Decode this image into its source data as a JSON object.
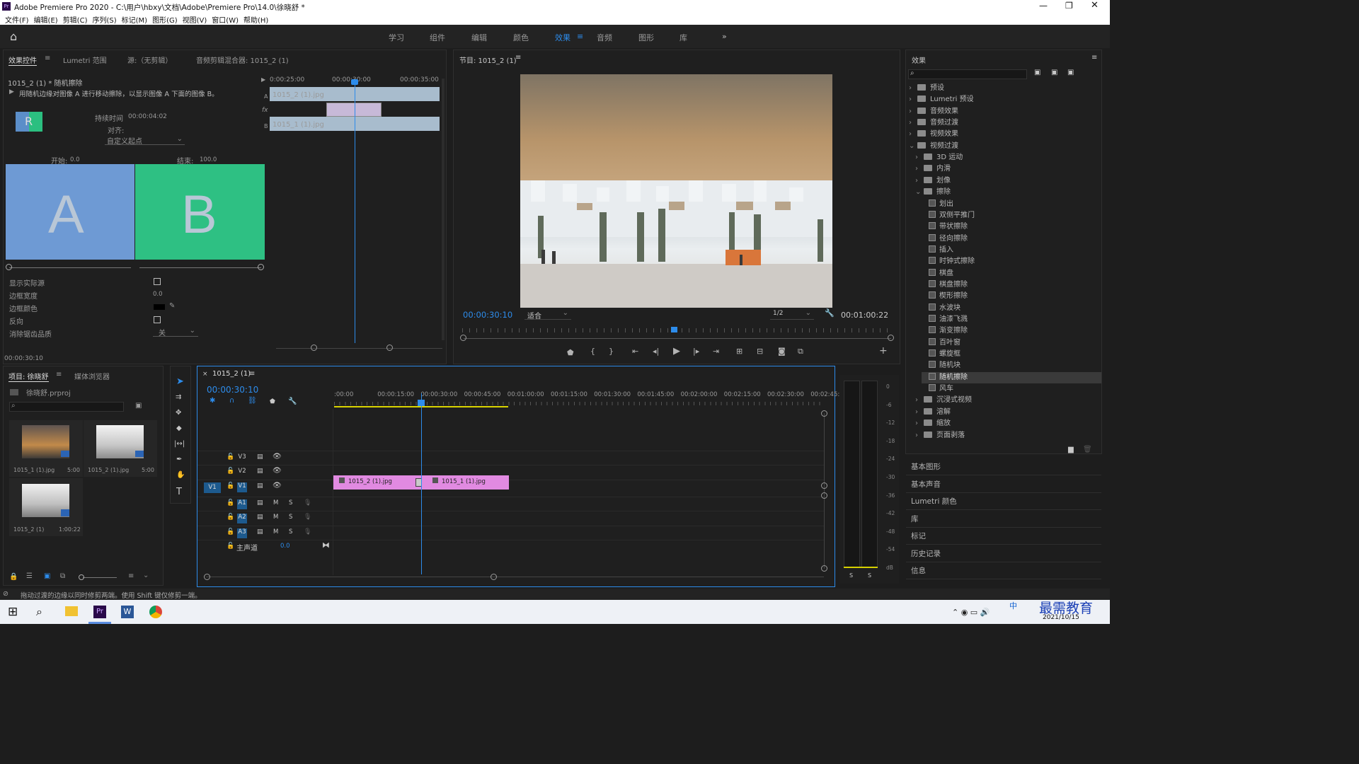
{
  "window": {
    "title": "Adobe Premiere Pro 2020 - C:\\用户\\hbxy\\文档\\Adobe\\Premiere Pro\\14.0\\徐晓舒 *",
    "app_icon": "Pr"
  },
  "menu": [
    "文件(F)",
    "编辑(E)",
    "剪辑(C)",
    "序列(S)",
    "标记(M)",
    "图形(G)",
    "视图(V)",
    "窗口(W)",
    "帮助(H)"
  ],
  "workspaces": [
    "学习",
    "组件",
    "编辑",
    "颜色",
    "效果",
    "音频",
    "图形",
    "库"
  ],
  "active_workspace": "效果",
  "effect_controls": {
    "tabs": [
      "效果控件",
      "Lumetri 范围",
      "源:（无剪辑）",
      "音频剪辑混合器: 1015_2 (1)"
    ],
    "clip_title": "1015_2 (1) * 随机擦除",
    "description": "用随机边缘对图像 A 进行移动擦除，以显示图像 A 下面的图像 B。",
    "duration_label": "持续时间",
    "duration": "00:00:04:02",
    "align_label": "对齐:",
    "align_value": "自定义起点",
    "start_label": "开始:",
    "start_value": "0.0",
    "end_label": "结束:",
    "end_value": "100.0",
    "a_label": "A",
    "b_label": "B",
    "thumb_letter": "R",
    "props": [
      {
        "label": "显示实际源",
        "value": ""
      },
      {
        "label": "边框宽度",
        "value": "0.0"
      },
      {
        "label": "边框颜色",
        "value": ""
      },
      {
        "label": "反向",
        "value": ""
      },
      {
        "label": "消除锯齿品质",
        "value": "关"
      }
    ],
    "ruler": [
      "0:00:25:00",
      "00:00:30:00",
      "00:00:35:00"
    ],
    "clip_a": "1015_2 (1).jpg",
    "clip_b": "1015_1 (1).jpg",
    "track_a": "A",
    "track_b": "B",
    "timecode": "00:00:30:10"
  },
  "program": {
    "title": "节目: 1015_2 (1)",
    "timecode": "00:00:30:10",
    "fit": "适合",
    "res": "1/2",
    "duration": "00:01:00:22"
  },
  "effects_panel": {
    "title": "效果",
    "tree": [
      {
        "label": "预设",
        "type": "folder",
        "level": 0,
        "open": false
      },
      {
        "label": "Lumetri 预设",
        "type": "folder",
        "level": 0,
        "open": false
      },
      {
        "label": "音频效果",
        "type": "folder",
        "level": 0,
        "open": false
      },
      {
        "label": "音频过渡",
        "type": "folder",
        "level": 0,
        "open": false
      },
      {
        "label": "视频效果",
        "type": "folder",
        "level": 0,
        "open": false
      },
      {
        "label": "视频过渡",
        "type": "folder",
        "level": 0,
        "open": true
      },
      {
        "label": "3D 运动",
        "type": "folder",
        "level": 1,
        "open": false
      },
      {
        "label": "内滑",
        "type": "folder",
        "level": 1,
        "open": false
      },
      {
        "label": "划像",
        "type": "folder",
        "level": 1,
        "open": false
      },
      {
        "label": "擦除",
        "type": "folder",
        "level": 1,
        "open": true
      },
      {
        "label": "划出",
        "type": "fx",
        "level": 2
      },
      {
        "label": "双侧平推门",
        "type": "fx",
        "level": 2
      },
      {
        "label": "带状擦除",
        "type": "fx",
        "level": 2
      },
      {
        "label": "径向擦除",
        "type": "fx",
        "level": 2
      },
      {
        "label": "插入",
        "type": "fx",
        "level": 2
      },
      {
        "label": "时钟式擦除",
        "type": "fx",
        "level": 2
      },
      {
        "label": "棋盘",
        "type": "fx",
        "level": 2
      },
      {
        "label": "棋盘擦除",
        "type": "fx",
        "level": 2
      },
      {
        "label": "楔形擦除",
        "type": "fx",
        "level": 2
      },
      {
        "label": "水波块",
        "type": "fx",
        "level": 2
      },
      {
        "label": "油漆飞溅",
        "type": "fx",
        "level": 2
      },
      {
        "label": "渐变擦除",
        "type": "fx",
        "level": 2
      },
      {
        "label": "百叶窗",
        "type": "fx",
        "level": 2
      },
      {
        "label": "螺旋框",
        "type": "fx",
        "level": 2
      },
      {
        "label": "随机块",
        "type": "fx",
        "level": 2
      },
      {
        "label": "随机擦除",
        "type": "fx",
        "level": 2,
        "selected": true
      },
      {
        "label": "风车",
        "type": "fx",
        "level": 2
      },
      {
        "label": "沉浸式视频",
        "type": "folder",
        "level": 1,
        "open": false
      },
      {
        "label": "溶解",
        "type": "folder",
        "level": 1,
        "open": false
      },
      {
        "label": "缩放",
        "type": "folder",
        "level": 1,
        "open": false
      },
      {
        "label": "页面剥落",
        "type": "folder",
        "level": 1,
        "open": false
      }
    ],
    "sections": [
      "基本图形",
      "基本声音",
      "Lumetri 颜色",
      "库",
      "标记",
      "历史记录",
      "信息"
    ]
  },
  "project": {
    "tabs": [
      "项目: 徐晓舒",
      "媒体浏览器"
    ],
    "file": "徐晓舒.prproj",
    "items": [
      {
        "name": "1015_1 (1).jpg",
        "dur": "5:00"
      },
      {
        "name": "1015_2 (1).jpg",
        "dur": "5:00"
      },
      {
        "name": "1015_2 (1)",
        "dur": "1:00:22"
      }
    ]
  },
  "timeline": {
    "tab": "1015_2 (1)",
    "timecode": "00:00:30:10",
    "ruler": [
      ":00:00",
      "00:00:15:00",
      "00:00:30:00",
      "00:00:45:00",
      "00:01:00:00",
      "00:01:15:00",
      "00:01:30:00",
      "00:01:45:00",
      "00:02:00:00",
      "00:02:15:00",
      "00:02:30:00",
      "00:02:45:"
    ],
    "video_tracks": [
      "V3",
      "V2",
      "V1"
    ],
    "audio_tracks": [
      "A1",
      "A2",
      "A3"
    ],
    "src_patch": "V1",
    "master_label": "主声道",
    "master_value": "0.0",
    "clips": [
      "1015_2 (1).jpg",
      "1015_1 (1).jpg"
    ],
    "mute": "M",
    "solo": "S"
  },
  "meter": {
    "scale": [
      "0",
      "-6",
      "-12",
      "-18",
      "-24",
      "-30",
      "-36",
      "-42",
      "-48",
      "-54",
      "dB"
    ],
    "solo": [
      "S",
      "S"
    ]
  },
  "status": "拖动过渡的边缘以同时修剪两端。使用 Shift 键仅修剪一端。",
  "taskbar": {
    "date": "2021/10/15",
    "ime": "中",
    "watermark": "最需教育"
  }
}
